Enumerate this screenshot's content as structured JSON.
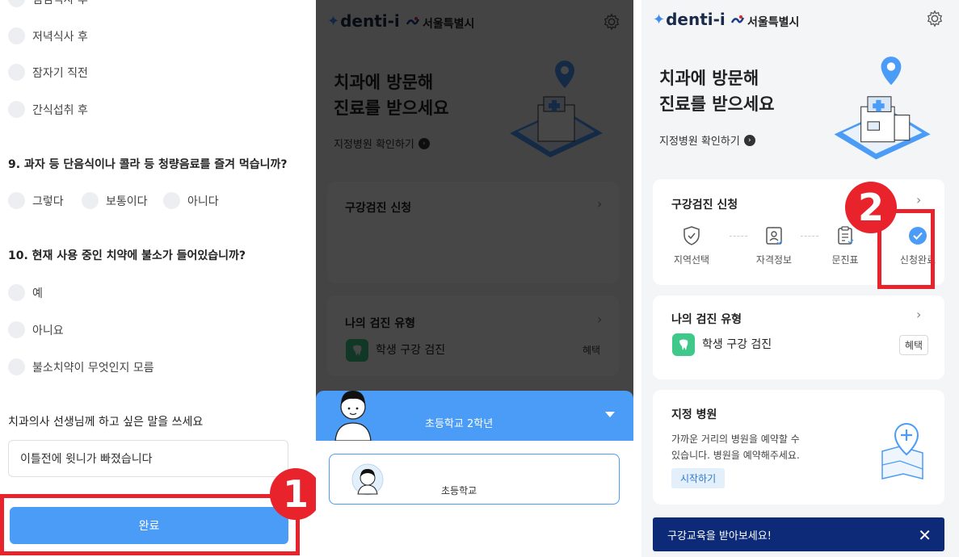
{
  "survey": {
    "partial_option": "점심식사 후",
    "q8_options": [
      "저녁식사 후",
      "잠자기 직전",
      "간식섭취 후"
    ],
    "q9": "9. 과자 등 단음식이나 콜라 등 청량음료를 즐겨 먹습니까?",
    "q9_options": [
      "그렇다",
      "보통이다",
      "아니다"
    ],
    "q10": "10. 현재 사용 중인 치약에 불소가 들어있습니까?",
    "q10_options": [
      "예",
      "아니요",
      "불소치약이 무엇인지 모름"
    ],
    "message_label": "치과의사 선생님께 하고 싶은 말을 쓰세요",
    "message_value": "이틀전에 윗니가 빠졌습니다",
    "submit_label": "완료",
    "step_badge": "1"
  },
  "app": {
    "logo_text": "denti-i",
    "logo_spark": "✦",
    "partner_text": "서울특별시",
    "headline_line1": "치과에 방문해",
    "headline_line2": "진료를 받으세요",
    "hospital_link": "지정병원 확인하기",
    "checkup_card": {
      "title": "구강검진 신청",
      "steps": [
        "지역선택",
        "자격정보",
        "문진표",
        "신청완료"
      ]
    },
    "type_card": {
      "title": "나의 검진 유형",
      "item": "학생 구강 검진",
      "tag": "혜택"
    },
    "hospital_card": {
      "title": "지정 병원",
      "desc_line1": "가까운 거리의 병원을 예약할 수",
      "desc_line2": "있습니다. 병원을 예약해주세요.",
      "button": "시작하기"
    },
    "banner": "구강교육을 받아보세요!",
    "banner_close": "✕",
    "step_badge": "2",
    "chevron": "›",
    "link_arrow": "›"
  },
  "overlay": {
    "grade_label": "초등학교 2학년",
    "school_label": "초등학교"
  },
  "colors": {
    "accent_blue": "#4b9cf7",
    "highlight_red": "#e8232b",
    "banner_navy": "#0c2a78",
    "tooth_green": "#3ec98a"
  }
}
